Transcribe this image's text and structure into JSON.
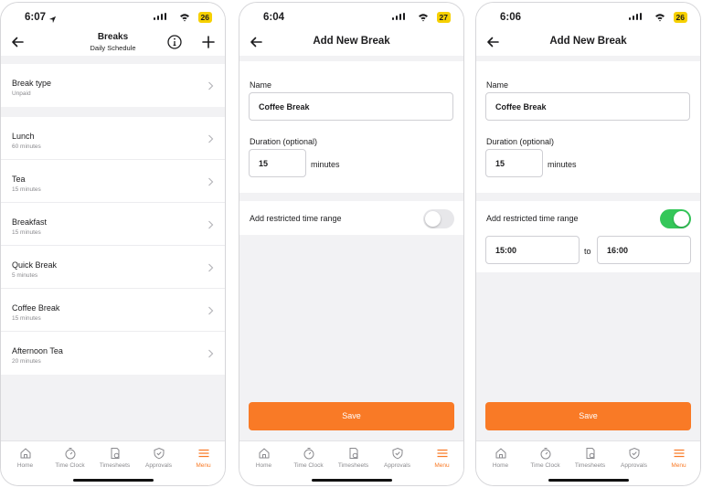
{
  "accent_color": "#f97a26",
  "toggle_on_color": "#34c759",
  "tabs": [
    "Home",
    "Time Clock",
    "Timesheets",
    "Approvals",
    "Menu"
  ],
  "active_tab": "Menu",
  "screen1": {
    "time": "6:07",
    "battery": "26",
    "title": "Breaks",
    "subtitle": "Daily Schedule",
    "break_type": {
      "label": "Break type",
      "value": "Unpaid"
    },
    "breaks": [
      {
        "name": "Lunch",
        "duration": "60 minutes"
      },
      {
        "name": "Tea",
        "duration": "15 minutes"
      },
      {
        "name": "Breakfast",
        "duration": "15 minutes"
      },
      {
        "name": "Quick Break",
        "duration": "5 minutes"
      },
      {
        "name": "Coffee Break",
        "duration": "15 minutes"
      },
      {
        "name": "Afternoon Tea",
        "duration": "20 minutes"
      }
    ]
  },
  "screen2": {
    "time": "6:04",
    "battery": "27",
    "title": "Add New Break",
    "name_label": "Name",
    "name_value": "Coffee Break",
    "duration_label": "Duration (optional)",
    "duration_value": "15",
    "duration_unit": "minutes",
    "restrict_label": "Add restricted time range",
    "restrict_on": false,
    "save_label": "Save"
  },
  "screen3": {
    "time": "6:06",
    "battery": "26",
    "title": "Add New Break",
    "name_label": "Name",
    "name_value": "Coffee Break",
    "duration_label": "Duration (optional)",
    "duration_value": "15",
    "duration_unit": "minutes",
    "restrict_label": "Add restricted time range",
    "restrict_on": true,
    "from_time": "15:00",
    "to_label": "to",
    "to_time": "16:00",
    "save_label": "Save"
  }
}
